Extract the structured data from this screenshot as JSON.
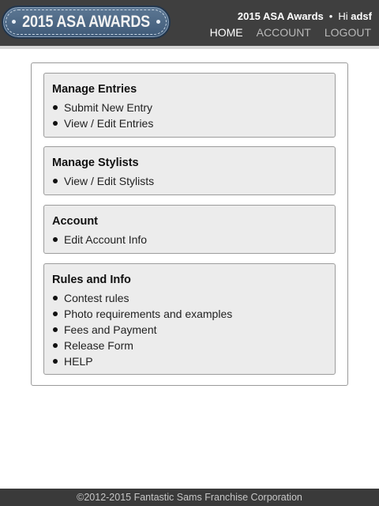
{
  "header": {
    "logo_text": "2015 ASA AWARDS",
    "app_title": "2015 ASA Awards",
    "separator": "•",
    "greeting": "Hi",
    "username": "adsf",
    "nav": [
      {
        "label": "HOME",
        "active": true
      },
      {
        "label": "ACCOUNT",
        "active": false
      },
      {
        "label": "LOGOUT",
        "active": false
      }
    ]
  },
  "panels": [
    {
      "title": "Manage Entries",
      "items": [
        "Submit New Entry",
        "View / Edit Entries"
      ]
    },
    {
      "title": "Manage Stylists",
      "items": [
        "View / Edit Stylists"
      ]
    },
    {
      "title": "Account",
      "items": [
        "Edit Account Info"
      ]
    },
    {
      "title": "Rules and Info",
      "items": [
        "Contest rules",
        "Photo requirements and examples",
        "Fees and Payment",
        "Release Form",
        "HELP"
      ]
    }
  ],
  "footer": {
    "text": "©2012-2015 Fantastic Sams Franchise Corporation"
  },
  "colors": {
    "header_bg": "#3f3f3f",
    "panel_bg": "#ececec",
    "logo_blue": "#4a6684"
  }
}
